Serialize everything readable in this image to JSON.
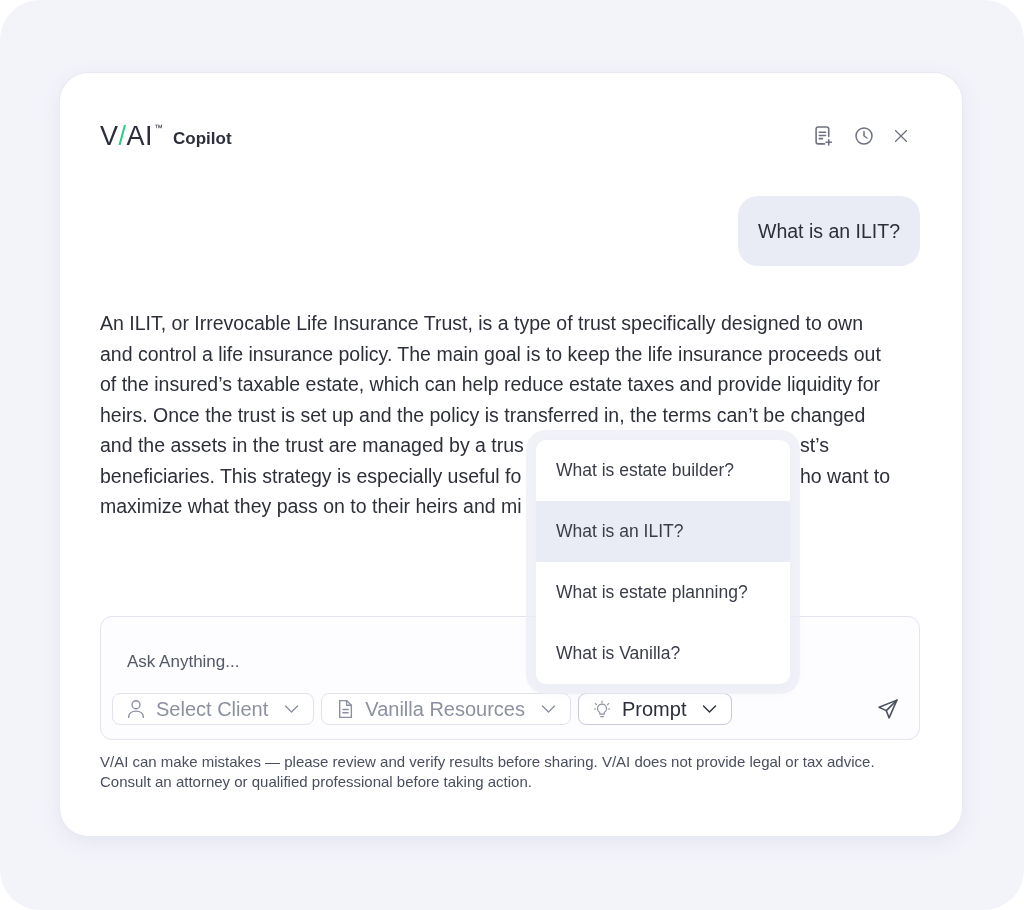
{
  "header": {
    "logo": {
      "parts": [
        {
          "text": "V",
          "accent": false
        },
        {
          "text": "/",
          "accent": true
        },
        {
          "text": "AI",
          "accent": false
        }
      ],
      "trademark": "™"
    },
    "product": "Copilot"
  },
  "conversation": {
    "user_message": "What is an ILIT?",
    "answer": {
      "lines": [
        {
          "text": "An ILIT, or Irrevocable Life Insurance Trust, is a type of trust specifically designed to own"
        },
        {
          "text": "and control a life insurance policy. The main goal is to keep the life insurance proceeds out"
        },
        {
          "text": "of the insured’s taxable estate, which can help reduce estate taxes and provide liquidity for"
        },
        {
          "text": "heirs. Once the trust is set up and the policy is transferred in, the terms can’t be changed"
        },
        {
          "text": "and the assets in the trust are managed by a trus",
          "after_menu": "st’s"
        },
        {
          "text": "beneficiaries. This strategy is especially useful fo",
          "after_menu": "ho want to"
        },
        {
          "text": "maximize what they pass on to their heirs and mi"
        }
      ]
    }
  },
  "composer": {
    "placeholder": "Ask Anything...",
    "chips": [
      {
        "kind": "client",
        "label": "Select Client",
        "open": false
      },
      {
        "kind": "resources",
        "label": "Vanilla Resources",
        "open": false
      },
      {
        "kind": "prompt",
        "label": "Prompt",
        "open": true
      }
    ]
  },
  "prompt_menu": {
    "items": [
      {
        "label": "What is estate builder?",
        "selected": false
      },
      {
        "label": "What is an ILIT?",
        "selected": true
      },
      {
        "label": "What is estate planning?",
        "selected": false
      },
      {
        "label": "What is Vanilla?",
        "selected": false
      }
    ]
  },
  "disclaimer": "V/AI can make mistakes — please review and verify results before sharing. V/AI does not provide legal or tax advice. Consult an attorney or qualified professional before taking action."
}
